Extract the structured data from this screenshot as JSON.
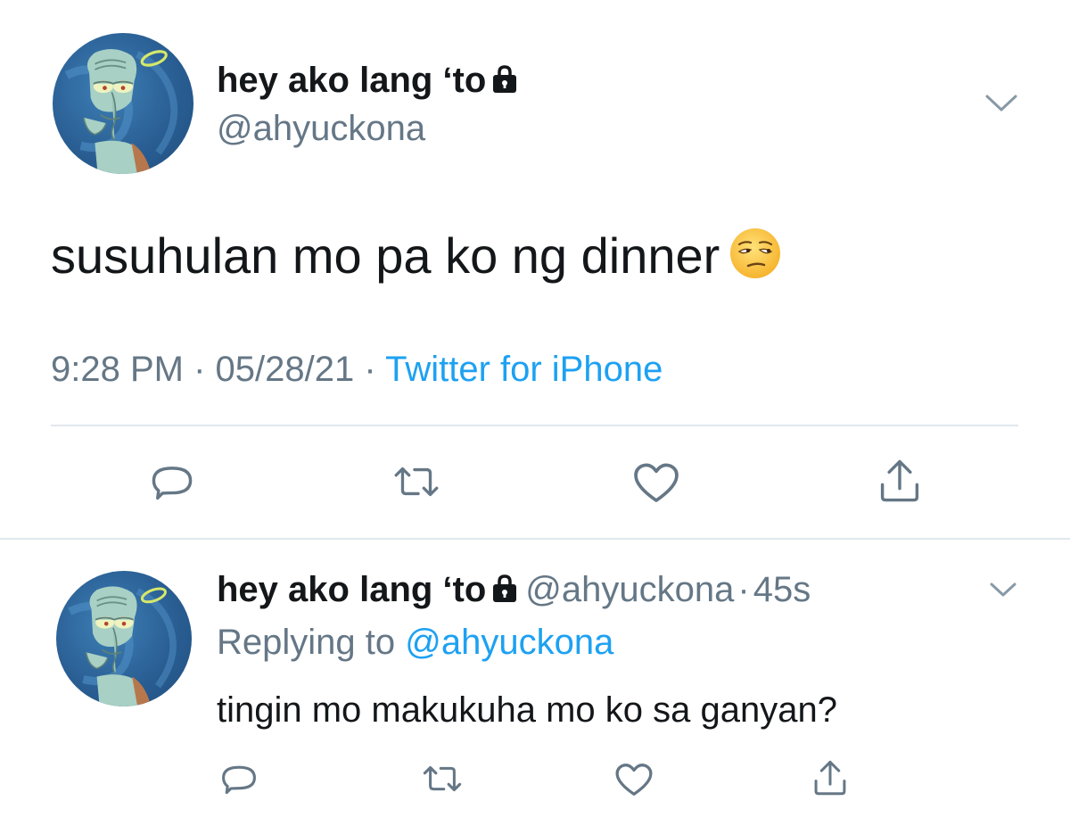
{
  "tweet": {
    "display_name": "hey ako lang ‘to",
    "handle": "@ahyuckona",
    "text": "susuhulan mo pa ko ng dinner",
    "emoji_icon": "unamused-face-icon",
    "time": "9:28 PM",
    "separator": "·",
    "date": "05/28/21",
    "source": "Twitter for iPhone",
    "actions": [
      "reply-icon",
      "retweet-icon",
      "like-icon",
      "share-icon"
    ]
  },
  "reply": {
    "display_name": "hey ako lang ‘to",
    "handle": "@ahyuckona",
    "separator": "·",
    "age": "45s",
    "replying_prefix": "Replying to",
    "replying_to": "@ahyuckona",
    "text": "tingin mo makukuha mo ko sa ganyan?",
    "actions": [
      "reply-icon",
      "retweet-icon",
      "like-icon",
      "share-icon"
    ]
  },
  "colors": {
    "text": "#14171a",
    "secondary": "#657786",
    "link": "#1da1f2",
    "divider": "#e1e8ed",
    "icon": "#657786"
  }
}
